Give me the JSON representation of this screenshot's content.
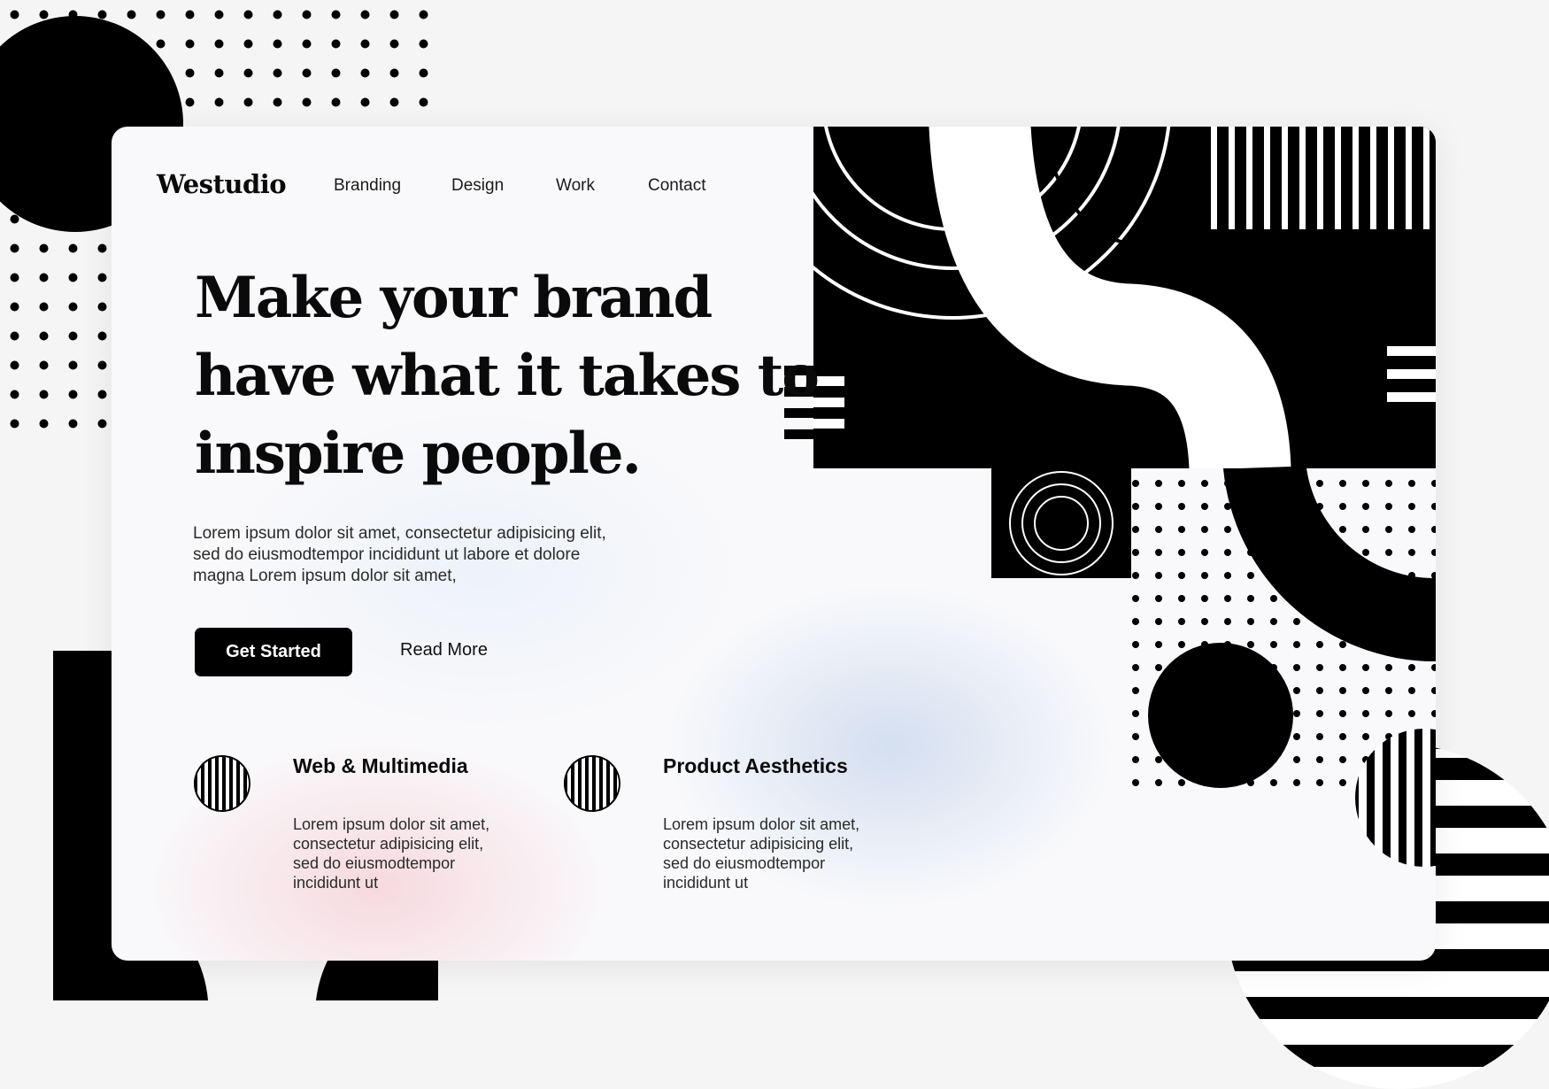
{
  "brand": {
    "logo": "Westudio"
  },
  "nav": {
    "items": [
      {
        "label": "Branding"
      },
      {
        "label": "Design"
      },
      {
        "label": "Work"
      },
      {
        "label": "Contact"
      }
    ]
  },
  "hero": {
    "headline_lines": [
      "Make your brand",
      "have what it takes to",
      "inspire people."
    ],
    "lead_lines": [
      "Lorem ipsum dolor sit amet, consectetur adipisicing elit,",
      "sed do eiusmodtempor incididunt ut labore et dolore",
      "magna Lorem ipsum dolor sit amet,"
    ],
    "cta_primary": "Get Started",
    "cta_secondary": "Read More"
  },
  "features": [
    {
      "title": "Web & Multimedia",
      "icon": "striped-circle-icon",
      "text_lines": [
        "Lorem ipsum dolor sit amet,",
        "consectetur adipisicing elit,",
        "sed do eiusmodtempor",
        "incididunt ut"
      ]
    },
    {
      "title": "Product Aesthetics",
      "icon": "striped-circle-icon",
      "text_lines": [
        "Lorem ipsum dolor sit amet,",
        "consectetur adipisicing elit,",
        "sed do eiusmodtempor",
        "incididunt ut"
      ]
    }
  ],
  "colors": {
    "ink": "#000000",
    "paper": "#ffffff",
    "page_background": "#f6f5f6",
    "blush": "#f6d6dc",
    "haze_blue": "#cddaee"
  }
}
